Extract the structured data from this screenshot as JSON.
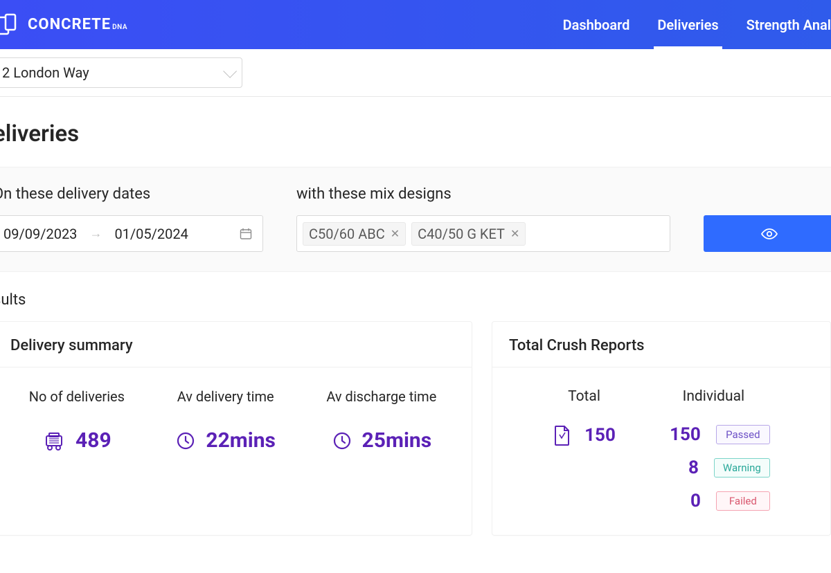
{
  "brand": {
    "name": "CONCRETE",
    "suffix": "DNA"
  },
  "nav": {
    "items": [
      {
        "label": "Dashboard",
        "active": false
      },
      {
        "label": "Deliveries",
        "active": true
      },
      {
        "label": "Strength Anal",
        "active": false
      }
    ]
  },
  "location": {
    "selected": "2 London Way"
  },
  "page": {
    "title": "eliveries",
    "results_label": "sults"
  },
  "filters": {
    "dates_label": "On these delivery dates",
    "mix_label": "with these mix designs",
    "date_from": "09/09/2023",
    "date_to": "01/05/2024",
    "mix_tags": [
      {
        "label": "C50/60 ABC"
      },
      {
        "label": "C40/50 G KET"
      }
    ]
  },
  "delivery_summary": {
    "title": "Delivery summary",
    "metrics": {
      "count": {
        "label": "No of deliveries",
        "value": "489"
      },
      "delivery_time": {
        "label": "Av delivery time",
        "value": "22mins"
      },
      "discharge_time": {
        "label": "Av discharge time",
        "value": "25mins"
      }
    }
  },
  "crush": {
    "title": "Total Crush Reports",
    "total_label": "Total",
    "individual_label": "Individual",
    "total_value": "150",
    "rows": [
      {
        "value": "150",
        "status": "Passed"
      },
      {
        "value": "8",
        "status": "Warning"
      },
      {
        "value": "0",
        "status": "Failed"
      }
    ]
  },
  "colors": {
    "primary": "#2f6bff",
    "accent": "#5b21b6"
  }
}
